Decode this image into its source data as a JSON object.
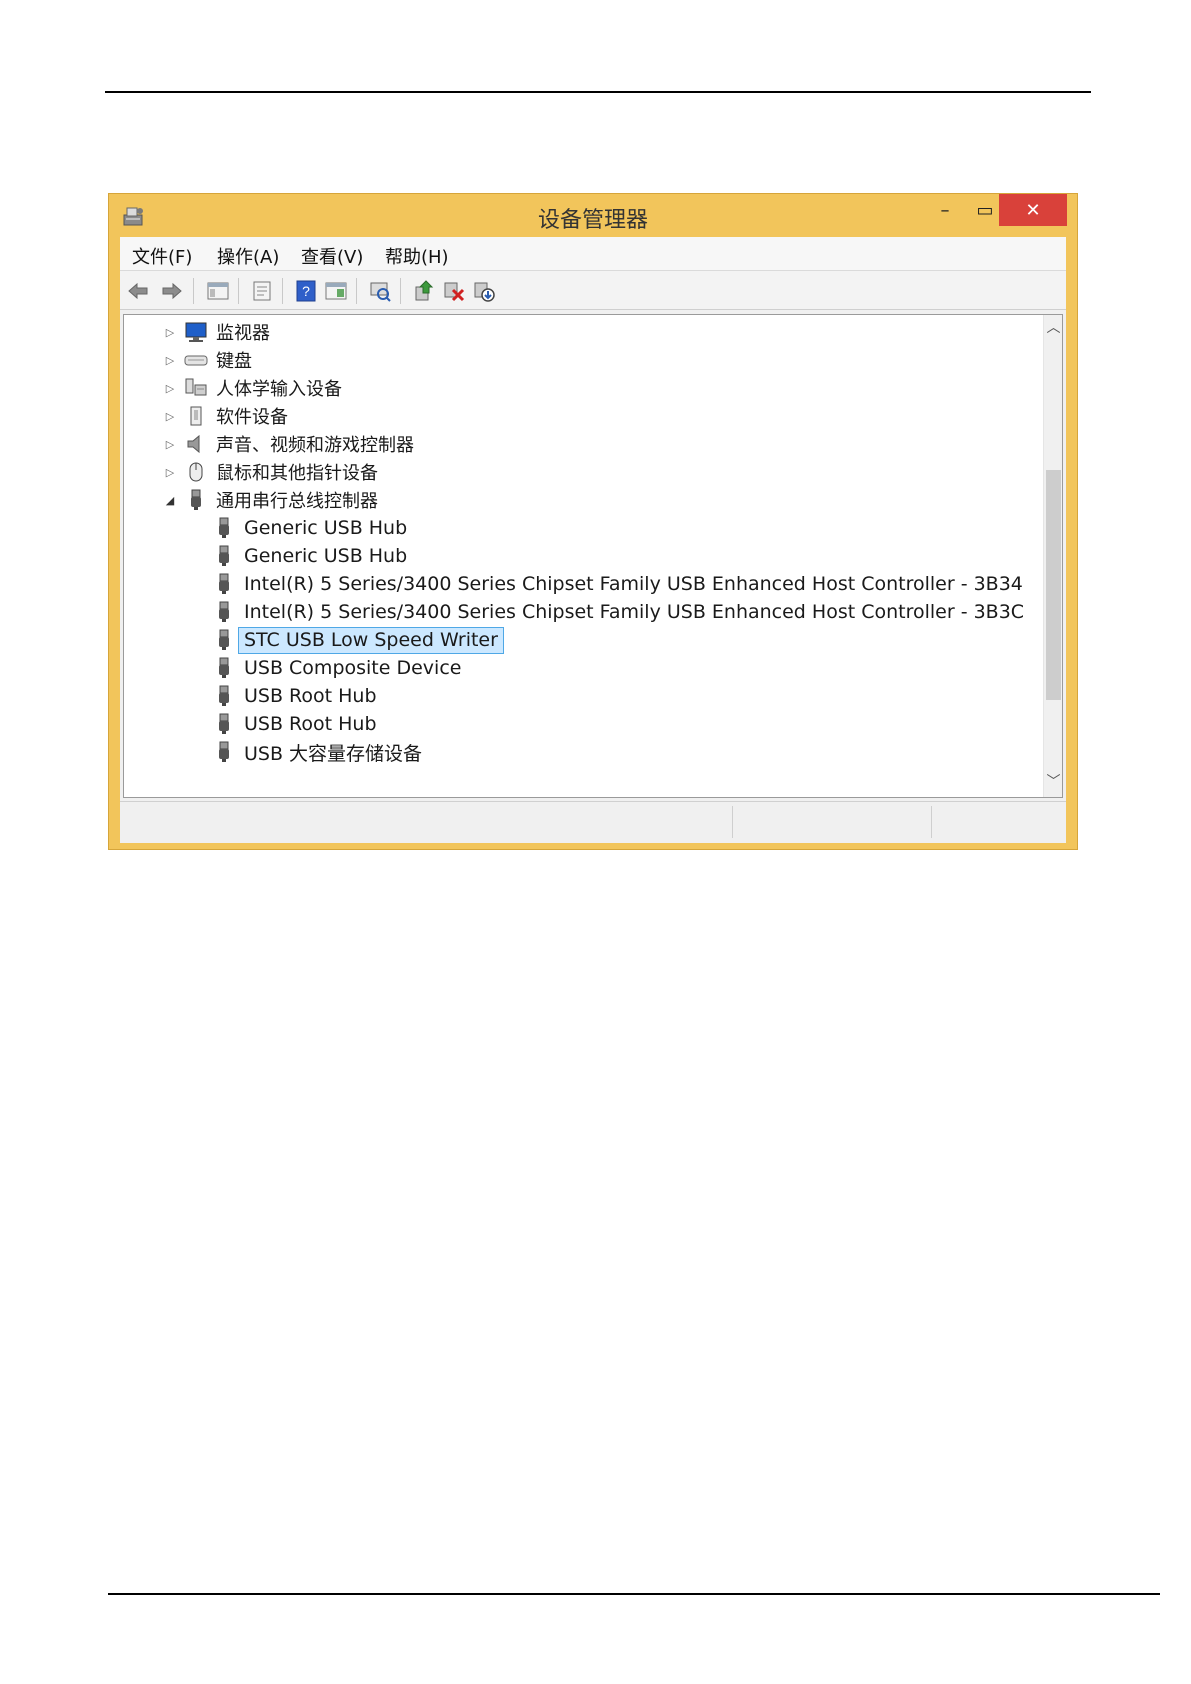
{
  "window": {
    "title": "设备管理器",
    "close_glyph": "✕",
    "minimize_glyph": "–",
    "maximize_glyph": "▭"
  },
  "menu": [
    {
      "label": "文件(F)"
    },
    {
      "label": "操作(A)"
    },
    {
      "label": "查看(V)"
    },
    {
      "label": "帮助(H)"
    }
  ],
  "toolbar": {
    "icons": [
      "back-arrow-icon",
      "forward-arrow-icon",
      "show-hide-console-tree-icon",
      "properties-icon",
      "help-icon",
      "view-icon",
      "scan-hardware-changes-icon",
      "update-driver-icon",
      "uninstall-device-icon",
      "disable-device-icon"
    ]
  },
  "tree": {
    "categories": [
      {
        "label": "监视器",
        "expanded": false,
        "icon": "monitor-icon"
      },
      {
        "label": "键盘",
        "expanded": false,
        "icon": "keyboard-icon"
      },
      {
        "label": "人体学输入设备",
        "expanded": false,
        "icon": "hid-icon"
      },
      {
        "label": "软件设备",
        "expanded": false,
        "icon": "software-device-icon"
      },
      {
        "label": "声音、视频和游戏控制器",
        "expanded": false,
        "icon": "speaker-icon"
      },
      {
        "label": "鼠标和其他指针设备",
        "expanded": false,
        "icon": "mouse-icon"
      },
      {
        "label": "通用串行总线控制器",
        "expanded": true,
        "icon": "usb-plug-icon"
      }
    ],
    "usb_devices": [
      {
        "label": "Generic USB Hub",
        "selected": false
      },
      {
        "label": "Generic USB Hub",
        "selected": false
      },
      {
        "label": "Intel(R) 5 Series/3400 Series Chipset Family USB Enhanced Host Controller - 3B34",
        "selected": false
      },
      {
        "label": "Intel(R) 5 Series/3400 Series Chipset Family USB Enhanced Host Controller - 3B3C",
        "selected": false
      },
      {
        "label": "STC USB Low Speed Writer",
        "selected": true
      },
      {
        "label": "USB Composite Device",
        "selected": false
      },
      {
        "label": "USB Root Hub",
        "selected": false
      },
      {
        "label": "USB Root Hub",
        "selected": false
      },
      {
        "label": "USB 大容量存储设备",
        "selected": false
      }
    ]
  },
  "colors": {
    "frame": "#f2c55b",
    "close": "#d9413a",
    "selection_fill": "#cce8ff",
    "selection_border": "#4fa8e6"
  }
}
